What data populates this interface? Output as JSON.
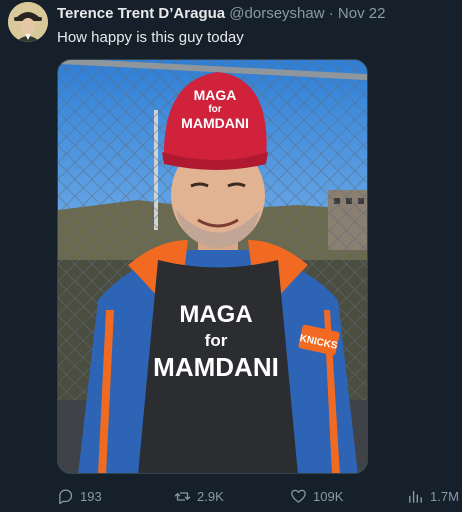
{
  "author": {
    "name": "Terence Trent D’Aragua",
    "handle": "@dorseyshaw",
    "separator": "·",
    "date": "Nov 22"
  },
  "tweet": {
    "text": "How happy is this guy today"
  },
  "media": {
    "hat_line1": "MAGA",
    "hat_line2": "for",
    "hat_line3": "MAMDANI",
    "shirt_line1": "MAGA",
    "shirt_line2": "for",
    "shirt_line3": "MAMDANI",
    "jacket_logo": "KNICKS"
  },
  "actions": {
    "replies": "193",
    "reposts": "2.9K",
    "likes": "109K",
    "views": "1.7M"
  },
  "colors": {
    "background": "#15202b",
    "secondary_text": "#8b98a5",
    "hat_red": "#d0223a",
    "jacket_blue": "#2d64b5",
    "jacket_orange": "#f26a21"
  }
}
